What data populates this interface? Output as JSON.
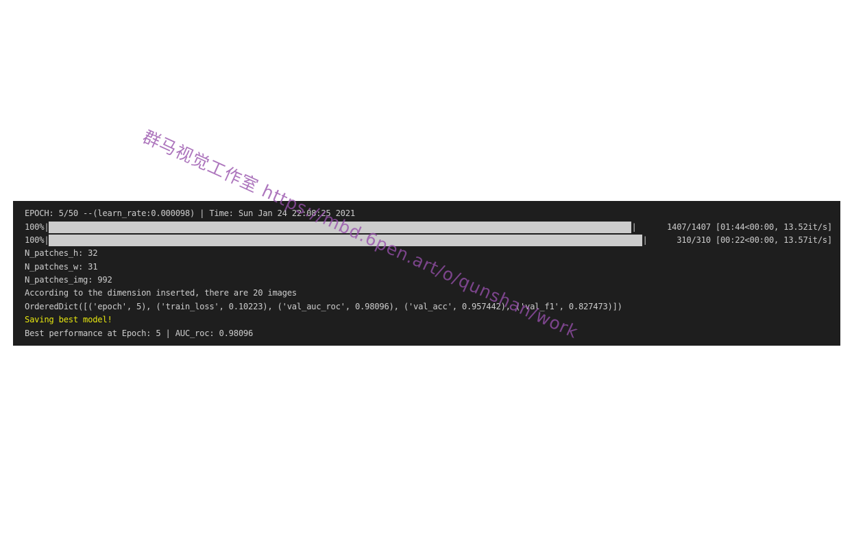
{
  "terminal": {
    "epoch_line": "EPOCH: 5/50 --(learn_rate:0.000098) | Time: Sun Jan 24 22:08:25 2021",
    "progress": [
      {
        "percent": "100%",
        "fraction": 1.0,
        "stats": "1407/1407 [01:44<00:00, 13.52it/s]"
      },
      {
        "percent": "100%",
        "fraction": 1.0,
        "stats": "310/310 [00:22<00:00, 13.57it/s]"
      }
    ],
    "lines": [
      "N_patches_h: 32",
      "N_patches_w: 31",
      "N_patches_img: 992",
      "According to the dimension inserted, there are 20 images",
      "OrderedDict([('epoch', 5), ('train_loss', 0.10223), ('val_auc_roc', 0.98096), ('val_acc', 0.957442), ('val_f1', 0.827473)])"
    ],
    "save_line": "Saving best model!",
    "best_line": "Best performance at Epoch: 5 | AUC_roc: 0.98096"
  },
  "watermark": {
    "text": "群马视觉工作室 https://mbd.6pen.art/o/qunshan/work",
    "color": "#9650aa"
  },
  "colors": {
    "terminal_bg": "#1e1e1e",
    "terminal_text": "#cccccc",
    "warning_text": "#e5e510"
  }
}
